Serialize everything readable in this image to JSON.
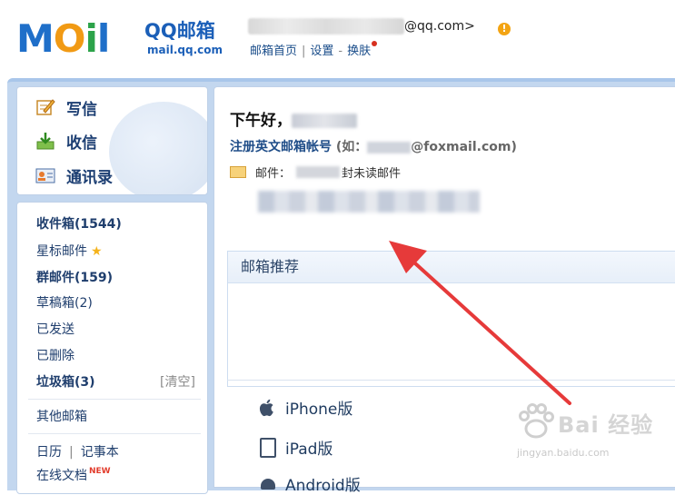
{
  "header": {
    "brand_cn": "QQ邮箱",
    "brand_url": "mail.qq.com",
    "logo_text": "MAIL",
    "account_suffix": "@qq.com>",
    "links": [
      "邮箱首页",
      "设置",
      "换肤"
    ],
    "link_separators": [
      "|",
      "-"
    ],
    "warning_symbol": "!"
  },
  "quick_actions": [
    {
      "label": "写信",
      "icon": "pencil-icon"
    },
    {
      "label": "收信",
      "icon": "inbox-download-icon"
    },
    {
      "label": "通讯录",
      "icon": "contacts-card-icon"
    }
  ],
  "folders": {
    "inbox": "收件箱(1544)",
    "starred": "星标邮件",
    "group": "群邮件(159)",
    "drafts": "草稿箱(2)",
    "sent": "已发送",
    "deleted": "已删除",
    "spam": "垃圾箱(3)",
    "spam_clear": "[清空]",
    "other": "其他邮箱",
    "calendar": "日历",
    "cal_sep": "|",
    "notes": "记事本",
    "docs": "在线文档",
    "docs_badge": "NEW"
  },
  "main": {
    "greeting": "下午好，",
    "register_link": "注册英文邮箱帐号",
    "register_hint_open": "(如：",
    "register_hint_domain": "@foxmail.com)",
    "mail_label": "邮件：",
    "unread_suffix": "封未读邮件",
    "recommend_title": "邮箱推荐",
    "apps": [
      {
        "label": "iPhone版",
        "icon": "apple-icon"
      },
      {
        "label": "iPad版",
        "icon": "ipad-icon"
      },
      {
        "label": "Android版",
        "icon": "android-icon"
      }
    ]
  },
  "watermark": {
    "text": "Bai 经验",
    "url": "jingyan.baidu.com"
  },
  "colors": {
    "frame": "#c3d7ef",
    "link": "#1f4d88",
    "arrow": "#e63a3a",
    "warning": "#f3a413"
  }
}
